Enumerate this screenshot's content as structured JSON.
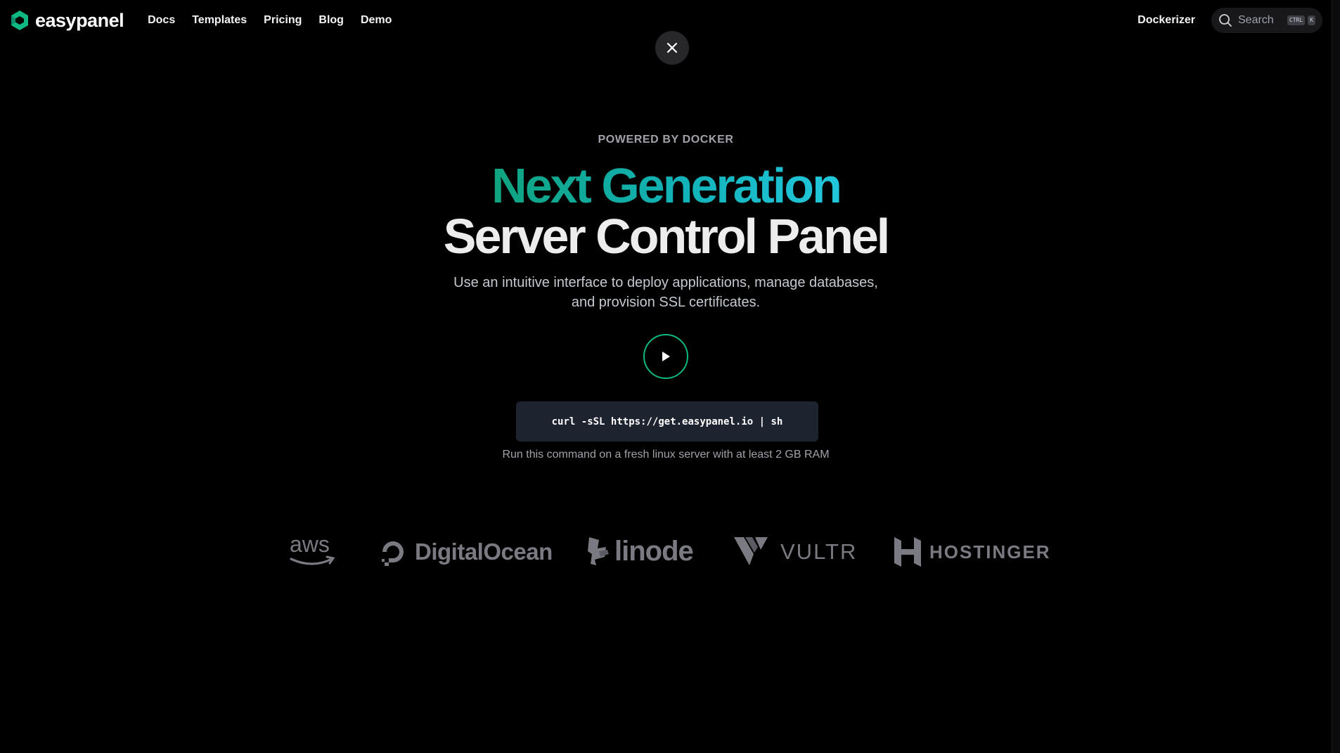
{
  "header": {
    "brand_name": "easypanel",
    "nav": [
      "Docs",
      "Templates",
      "Pricing",
      "Blog",
      "Demo"
    ],
    "dockerizer_label": "Dockerizer",
    "search": {
      "label": "Search",
      "keys": [
        "CTRL",
        "K"
      ]
    }
  },
  "hero": {
    "eyebrow": "POWERED BY DOCKER",
    "headline_line1": "Next Generation",
    "headline_line2": "Server Control Panel",
    "subtitle_line1": "Use an intuitive interface to deploy applications, manage databases,",
    "subtitle_line2": "and provision SSL certificates.",
    "command": "curl -sSL https://get.easypanel.io | sh",
    "command_hint": "Run this command on a fresh linux server with at least 2 GB RAM"
  },
  "providers": [
    "aws",
    "DigitalOcean",
    "linode",
    "VULTR",
    "HOSTINGER"
  ],
  "colors": {
    "background": "#000000",
    "accent_green": "#10b981",
    "gradient_start": "#10a37f",
    "gradient_end": "#22c7dc",
    "command_bg": "#1e2330"
  },
  "icons": {
    "brand": "easypanel-logo-icon",
    "search": "search-icon",
    "close": "close-icon",
    "play": "play-icon"
  }
}
